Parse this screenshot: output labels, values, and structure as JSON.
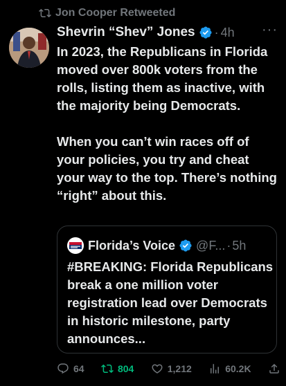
{
  "retweet_banner": {
    "text": "Jon Cooper Retweeted",
    "icon": "retweet-icon"
  },
  "tweet": {
    "display_name": "Shevrin “Shev” Jones",
    "separator": "·",
    "time": "4h",
    "more": "···",
    "text": "In 2023, the Republicans in Florida moved over 800k voters from the rolls, listing them as inactive, with the majority being Democrats.\n\nWhen you can’t win races off of your policies, you try and cheat your way to the top. There’s nothing “right” about this."
  },
  "quoted": {
    "display_name": "Florida’s Voice",
    "handle": "@F...",
    "separator": "·",
    "time": "5h",
    "text": "#BREAKING: Florida Republicans break a one million voter registration lead over Democrats in historic milestone, party announces..."
  },
  "actions": {
    "replies": "64",
    "retweets": "804",
    "likes": "1,212",
    "views": "60.2K"
  },
  "colors": {
    "background": "#000000",
    "text_primary": "#e7e9ea",
    "text_secondary": "#71767b",
    "verified": "#1d9bf0",
    "retweet_active": "#00ba7c",
    "border": "#2f3336"
  }
}
